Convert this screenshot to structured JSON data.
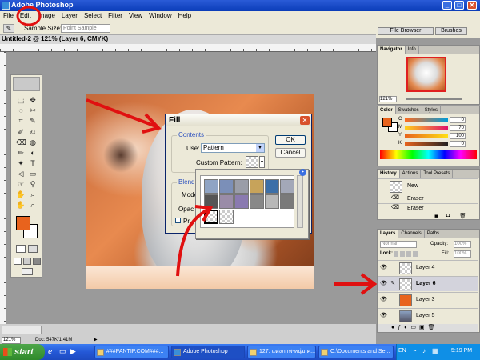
{
  "window": {
    "title": "Adobe Photoshop",
    "min": "_",
    "max": "□",
    "close": "✕"
  },
  "menu": [
    "File",
    "Edit",
    "Image",
    "Layer",
    "Select",
    "Filter",
    "View",
    "Window",
    "Help"
  ],
  "options": {
    "tool_glyph": "✎",
    "sample_label": "Sample Size:",
    "sample_value": "Point Sample"
  },
  "well": {
    "file_browser": "File Browser",
    "brushes": "Brushes"
  },
  "document": {
    "title": "Untitled-2 @ 121% (Layer 6, CMYK)",
    "zoom": "121%",
    "doc_info": "Doc: 547K/1.41M"
  },
  "toolbox": {
    "tools": [
      "⬚",
      "✥",
      "◌",
      "✂",
      "⌗",
      "✎",
      "✐",
      "⎌",
      "⌫",
      "◍",
      "✏",
      "◐",
      "✦",
      "T",
      "◁",
      "▭",
      "☞",
      "⚲",
      "✋",
      "⌕"
    ]
  },
  "fill_dialog": {
    "title": "Fill",
    "close_glyph": "✕",
    "contents_label": "Contents",
    "use_label": "Use:",
    "use_value": "Pattern",
    "custom_pattern_label": "Custom Pattern:",
    "blending_label": "Blendi",
    "mode_label": "Mode",
    "opacity_label": "Opac",
    "preserve_label": "Pr",
    "ok": "OK",
    "cancel": "Cancel"
  },
  "patterns": {
    "colors": [
      "#8fa4c4",
      "#7b8fb8",
      "#9a9da8",
      "#c7a35a",
      "#3c6fa8",
      "#a3a8b8",
      "#555555",
      "#9a8ca8",
      "#8a7ab0",
      "#888888",
      "#b8b8b8",
      "#7a7a7a"
    ]
  },
  "navigator": {
    "tabs": [
      "Navigator",
      "Info"
    ],
    "zoom": "121%"
  },
  "color_palette": {
    "tabs": [
      "Color",
      "Swatches",
      "Styles"
    ],
    "channels": [
      {
        "name": "C",
        "value": "0"
      },
      {
        "name": "M",
        "value": "70"
      },
      {
        "name": "Y",
        "value": "100"
      },
      {
        "name": "K",
        "value": "0"
      }
    ],
    "foreground": "#e8631d"
  },
  "history": {
    "tabs": [
      "History",
      "Actions",
      "Tool Presets"
    ],
    "items": [
      "New",
      "Eraser",
      "Eraser"
    ]
  },
  "layers": {
    "tabs": [
      "Layers",
      "Channels",
      "Paths"
    ],
    "blend_mode": "Normal",
    "opacity_label": "Opacity:",
    "opacity_value": "100%",
    "lock_label": "Lock:",
    "fill_label": "Fill:",
    "fill_value": "100%",
    "items": [
      {
        "name": "Layer 4",
        "selected": false
      },
      {
        "name": "Layer 6",
        "selected": true
      },
      {
        "name": "Layer 3",
        "selected": false
      },
      {
        "name": "Layer 5",
        "selected": false
      }
    ]
  },
  "taskbar": {
    "start": "start",
    "items": [
      {
        "label": "###PANTIP.COM###..."
      },
      {
        "label": "Adobe Photoshop"
      },
      {
        "label": "127. แต่งภาพ-หนุ่ม ค..."
      },
      {
        "label": "C:\\Documents and Se..."
      }
    ],
    "lang": "EN",
    "time": "5:19 PM"
  }
}
